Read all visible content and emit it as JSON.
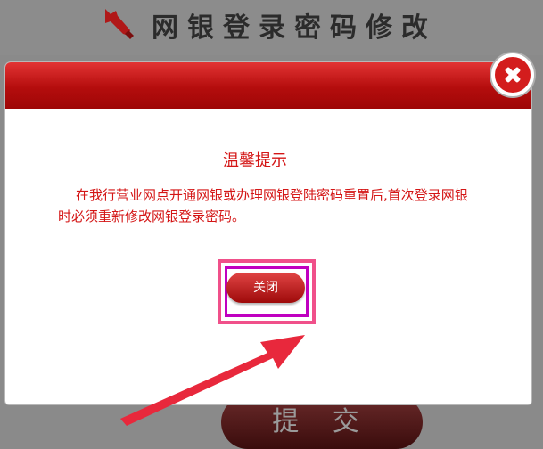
{
  "page": {
    "title": "网银登录密码修改",
    "submit_label": "提 交"
  },
  "dialog": {
    "notice_title": "温馨提示",
    "notice_body": "在我行营业网点开通网银或办理网银登陆密码重置后,首次登录网银时必须重新修改网银登录密码。",
    "close_label": "关闭"
  },
  "colors": {
    "accent_red": "#d41616",
    "header_red": "#b40d0d",
    "highlight_pink": "#f0508a"
  }
}
